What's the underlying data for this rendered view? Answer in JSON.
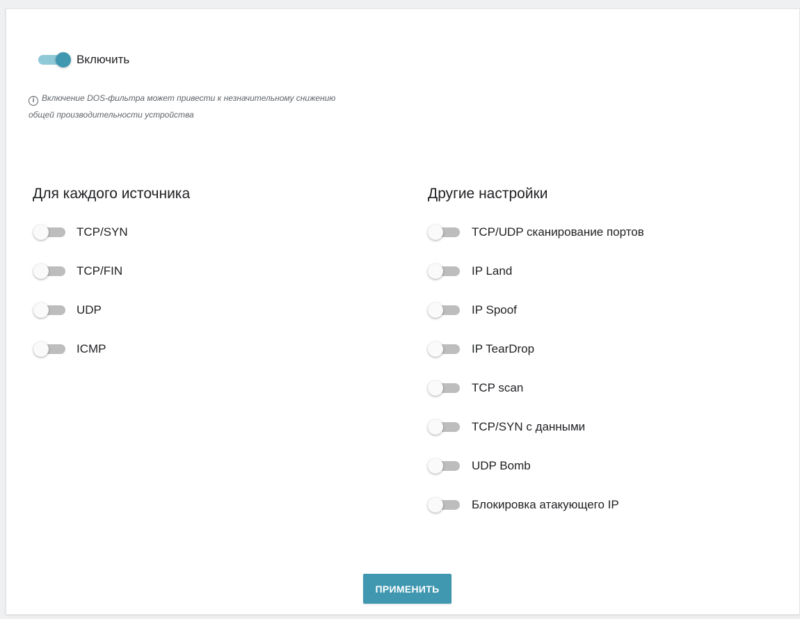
{
  "enable": {
    "label": "Включить",
    "state": "on"
  },
  "notice": {
    "icon": "info-icon",
    "text": "Включение DOS-фильтра может привести к незначительному снижению общей производительности устройства"
  },
  "per_source": {
    "title": "Для каждого источника",
    "items": [
      {
        "label": "TCP/SYN",
        "state": "off"
      },
      {
        "label": "TCP/FIN",
        "state": "off"
      },
      {
        "label": "UDP",
        "state": "off"
      },
      {
        "label": "ICMP",
        "state": "off"
      }
    ]
  },
  "other": {
    "title": "Другие настройки",
    "items": [
      {
        "label": "TCP/UDP сканирование портов",
        "state": "off"
      },
      {
        "label": "IP Land",
        "state": "off"
      },
      {
        "label": "IP Spoof",
        "state": "off"
      },
      {
        "label": "IP TearDrop",
        "state": "off"
      },
      {
        "label": "TCP scan",
        "state": "off"
      },
      {
        "label": "TCP/SYN с данными",
        "state": "off"
      },
      {
        "label": "UDP Bomb",
        "state": "off"
      },
      {
        "label": "Блокировка атакующего IP",
        "state": "off"
      }
    ]
  },
  "apply_button": {
    "label": "ПРИМЕНИТЬ"
  },
  "colors": {
    "accent": "#3f97b0",
    "accent_track": "#8fc8d6",
    "off_track": "#bdbdbd"
  }
}
